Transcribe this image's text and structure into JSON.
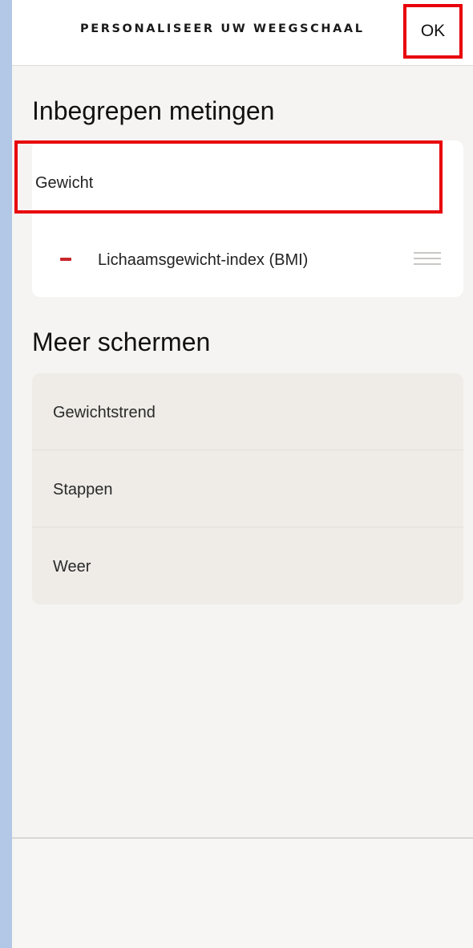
{
  "header": {
    "title": "PERSONALISEER UW WEEGSCHAAL",
    "ok_label": "OK"
  },
  "included_measurements": {
    "heading": "Inbegrepen metingen",
    "items": [
      {
        "label": "Gewicht"
      },
      {
        "label": "Lichaamsgewicht-index (BMI)",
        "remove_icon": "minus-icon",
        "drag_icon": "drag-handle-icon"
      }
    ]
  },
  "more_screens": {
    "heading": "Meer schermen",
    "items": [
      {
        "label": "Gewichtstrend"
      },
      {
        "label": "Stappen"
      },
      {
        "label": "Weer"
      }
    ]
  },
  "colors": {
    "highlight": "#e8000a",
    "remove": "#c8262a",
    "background": "#f5f4f2",
    "side_strip": "#b3c7e6"
  }
}
